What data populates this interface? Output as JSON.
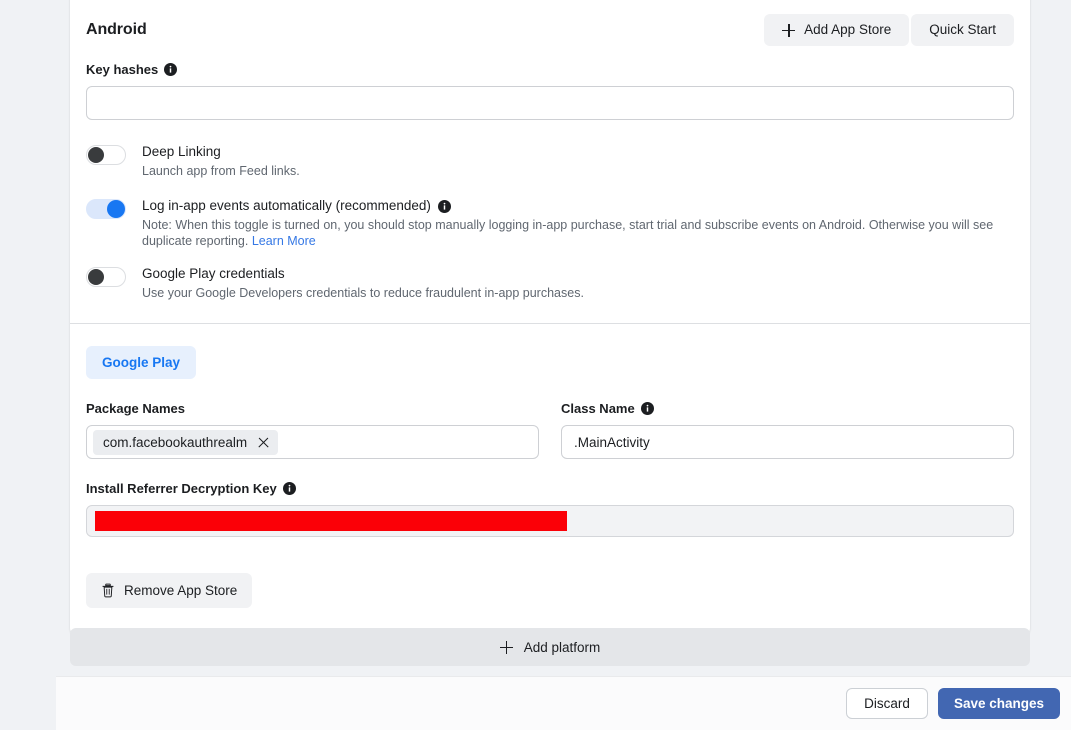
{
  "platform": {
    "title": "Android",
    "add_app_store_label": "Add App Store",
    "quick_start_label": "Quick Start"
  },
  "key_hashes": {
    "label": "Key hashes",
    "value": "",
    "placeholder": ""
  },
  "toggles": [
    {
      "title": "Deep Linking",
      "description": "Launch app from Feed links.",
      "state": "off",
      "has_info": false
    },
    {
      "title": "Log in-app events automatically (recommended)",
      "description": "Note: When this toggle is turned on, you should stop manually logging in-app purchase, start trial and subscribe events on Android. Otherwise you will see duplicate reporting.",
      "link_label": "Learn More",
      "state": "on",
      "has_info": true
    },
    {
      "title": "Google Play credentials",
      "description": "Use your Google Developers credentials to reduce fraudulent in-app purchases.",
      "state": "off",
      "has_info": false
    }
  ],
  "store": {
    "tab_label": "Google Play",
    "package_names": {
      "label": "Package Names",
      "tokens": [
        "com.facebookauthrealm"
      ]
    },
    "class_name": {
      "label": "Class Name",
      "value": ".MainActivity"
    },
    "install_referrer": {
      "label": "Install Referrer Decryption Key",
      "value": "",
      "redacted": true
    },
    "remove_label": "Remove App Store"
  },
  "add_platform_label": "Add platform",
  "footer": {
    "discard_label": "Discard",
    "save_label": "Save changes"
  },
  "colors": {
    "accent_blue": "#1877f2",
    "link_blue": "#3578e5",
    "save_blue": "#4267b2",
    "pill_bg": "#e7f0fd",
    "redaction_red": "#fb0007",
    "page_bg": "#f0f2f5"
  }
}
